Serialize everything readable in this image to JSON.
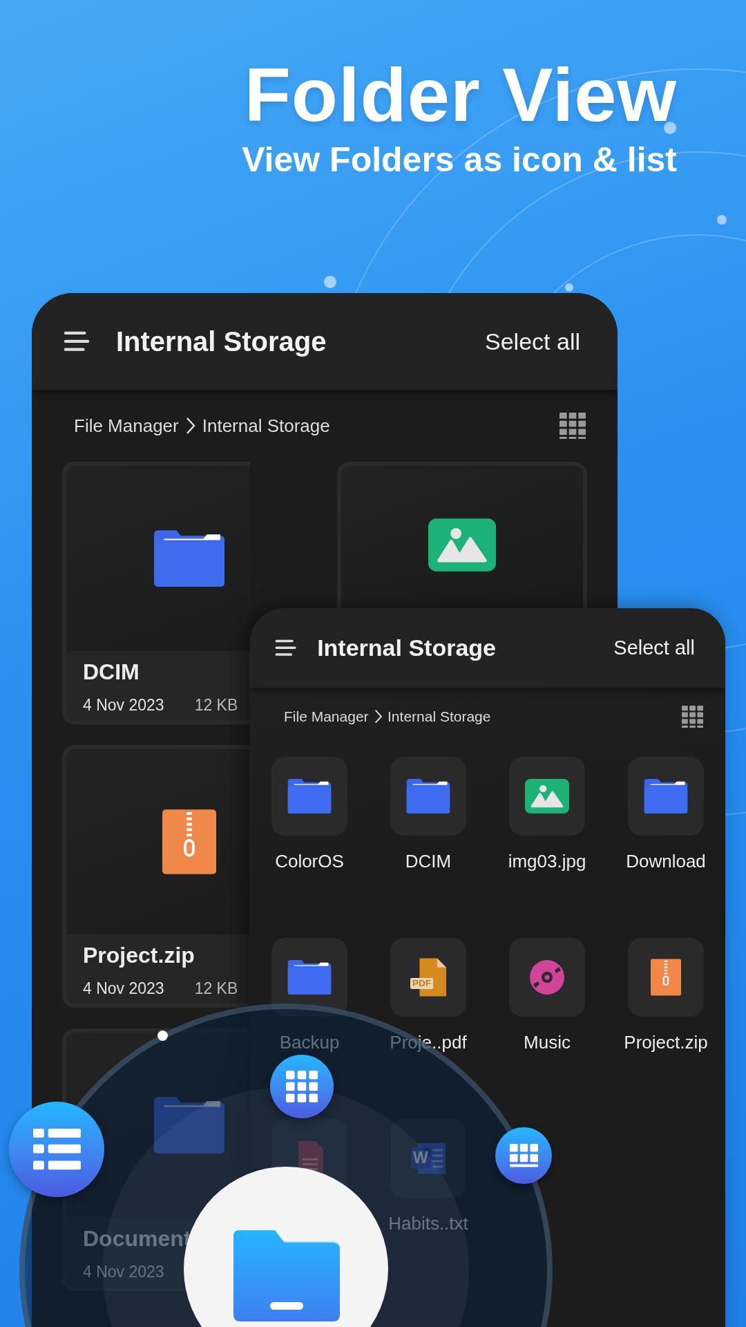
{
  "headline": {
    "title": "Folder View",
    "subtitle": "View Folders as icon & list"
  },
  "back_screen": {
    "title": "Internal Storage",
    "action": "Select all",
    "breadcrumb": [
      "File Manager",
      "Internal Storage"
    ],
    "cards": [
      {
        "kind": "folder",
        "name": "DCIM",
        "date": "4 Nov 2023",
        "size": "12 KB"
      },
      {
        "kind": "image"
      },
      {
        "kind": "zip",
        "name": "Project.zip",
        "date": "4 Nov 2023",
        "size": "12 KB"
      },
      {
        "kind": "folder",
        "name": "Document",
        "date": "4 Nov 2023"
      }
    ]
  },
  "front_screen": {
    "title": "Internal Storage",
    "action": "Select all",
    "breadcrumb": [
      "File Manager",
      "Internal Storage"
    ],
    "items": [
      {
        "kind": "folder",
        "name": "ColorOS"
      },
      {
        "kind": "folder",
        "name": "DCIM"
      },
      {
        "kind": "image",
        "name": "img03.jpg"
      },
      {
        "kind": "folder",
        "name": "Download"
      },
      {
        "kind": "folder",
        "name": "Backup"
      },
      {
        "kind": "pdf",
        "name": "Proje..pdf",
        "badge": "PDF"
      },
      {
        "kind": "music",
        "name": "Music"
      },
      {
        "kind": "zip",
        "name": "Project.zip"
      },
      {
        "kind": "doc"
      },
      {
        "kind": "word",
        "name": "Habits..txt",
        "badge": "W"
      }
    ]
  },
  "view_switcher": {
    "buttons": [
      {
        "kind": "list"
      },
      {
        "kind": "grid"
      },
      {
        "kind": "table"
      }
    ]
  }
}
